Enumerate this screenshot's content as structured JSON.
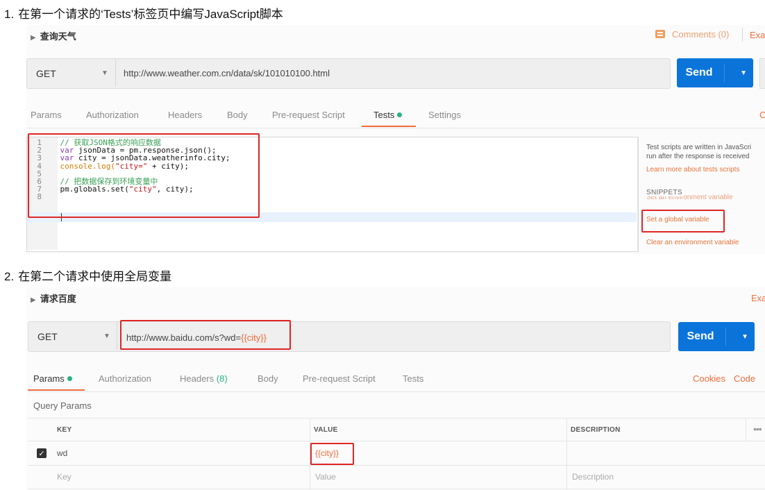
{
  "step1": {
    "number": "1.",
    "text": "在第一个请求的‘Tests’标签页中编写JavaScript脚本"
  },
  "step2": {
    "number": "2.",
    "text": "在第二个请求中使用全局变量"
  },
  "request1": {
    "name": "查询天气",
    "comments": "Comments (0)",
    "examples_truncated": "Exa",
    "method": "GET",
    "url": "http://www.weather.com.cn/data/sk/101010100.html",
    "send_label": "Send",
    "tabs": [
      "Params",
      "Authorization",
      "Headers",
      "Body",
      "Pre-request Script",
      "Tests",
      "Settings"
    ],
    "active_tab": "Tests",
    "right_truncated": "C",
    "code_lines": [
      {
        "n": "1",
        "parts": [
          {
            "t": "// 获取JSON格式的响应数据",
            "c": "cm"
          }
        ]
      },
      {
        "n": "2",
        "parts": [
          {
            "t": "var",
            "c": "kw"
          },
          {
            "t": " jsonData = pm.response.json();",
            "c": "tx"
          }
        ]
      },
      {
        "n": "3",
        "parts": [
          {
            "t": "var",
            "c": "kw"
          },
          {
            "t": " city = jsonData.weatherinfo.city;",
            "c": "tx"
          }
        ]
      },
      {
        "n": "4",
        "parts": [
          {
            "t": "console.log(",
            "c": "fn"
          },
          {
            "t": "\"city=\"",
            "c": "str"
          },
          {
            "t": " + city);",
            "c": "tx"
          }
        ]
      },
      {
        "n": "5",
        "parts": []
      },
      {
        "n": "6",
        "parts": [
          {
            "t": "// 把数据保存到环境变量中",
            "c": "cm"
          }
        ]
      },
      {
        "n": "7",
        "parts": [
          {
            "t": "pm.globals.set(",
            "c": "tx"
          },
          {
            "t": "\"city\"",
            "c": "str"
          },
          {
            "t": ", city);",
            "c": "tx"
          }
        ]
      },
      {
        "n": "8",
        "parts": []
      }
    ],
    "side": {
      "desc_line1": "Test scripts are written in JavaScri",
      "desc_line2": "run after the response is received",
      "learn_more": "Learn more about tests scripts",
      "snippets": "SNIPPETS",
      "set_env_hidden": "Set an environment variable",
      "set_global": "Set a global variable",
      "clear_env": "Clear an environment variable"
    }
  },
  "request2": {
    "name": "请求百度",
    "examples_truncated": "Exa",
    "method": "GET",
    "url_prefix": "http://www.baidu.com/s?wd=",
    "url_var": "{{city}}",
    "send_label": "Send",
    "tabs": [
      {
        "label": "Params",
        "dot": true
      },
      {
        "label": "Authorization"
      },
      {
        "label": "Headers",
        "count": "(8)"
      },
      {
        "label": "Body"
      },
      {
        "label": "Pre-request Script"
      },
      {
        "label": "Tests"
      }
    ],
    "cookies": "Cookies",
    "code": "Code",
    "query_params_title": "Query Params",
    "columns": [
      "KEY",
      "VALUE",
      "DESCRIPTION"
    ],
    "rows": [
      {
        "checked": true,
        "key": "wd",
        "value": "{{city}}",
        "description": ""
      }
    ],
    "placeholders": {
      "key": "Key",
      "value": "Value",
      "description": "Description"
    }
  },
  "colors": {
    "accent": "#f26b3a",
    "send": "#0a74da",
    "green": "#26b47f",
    "highlight_box": "#e02424"
  }
}
